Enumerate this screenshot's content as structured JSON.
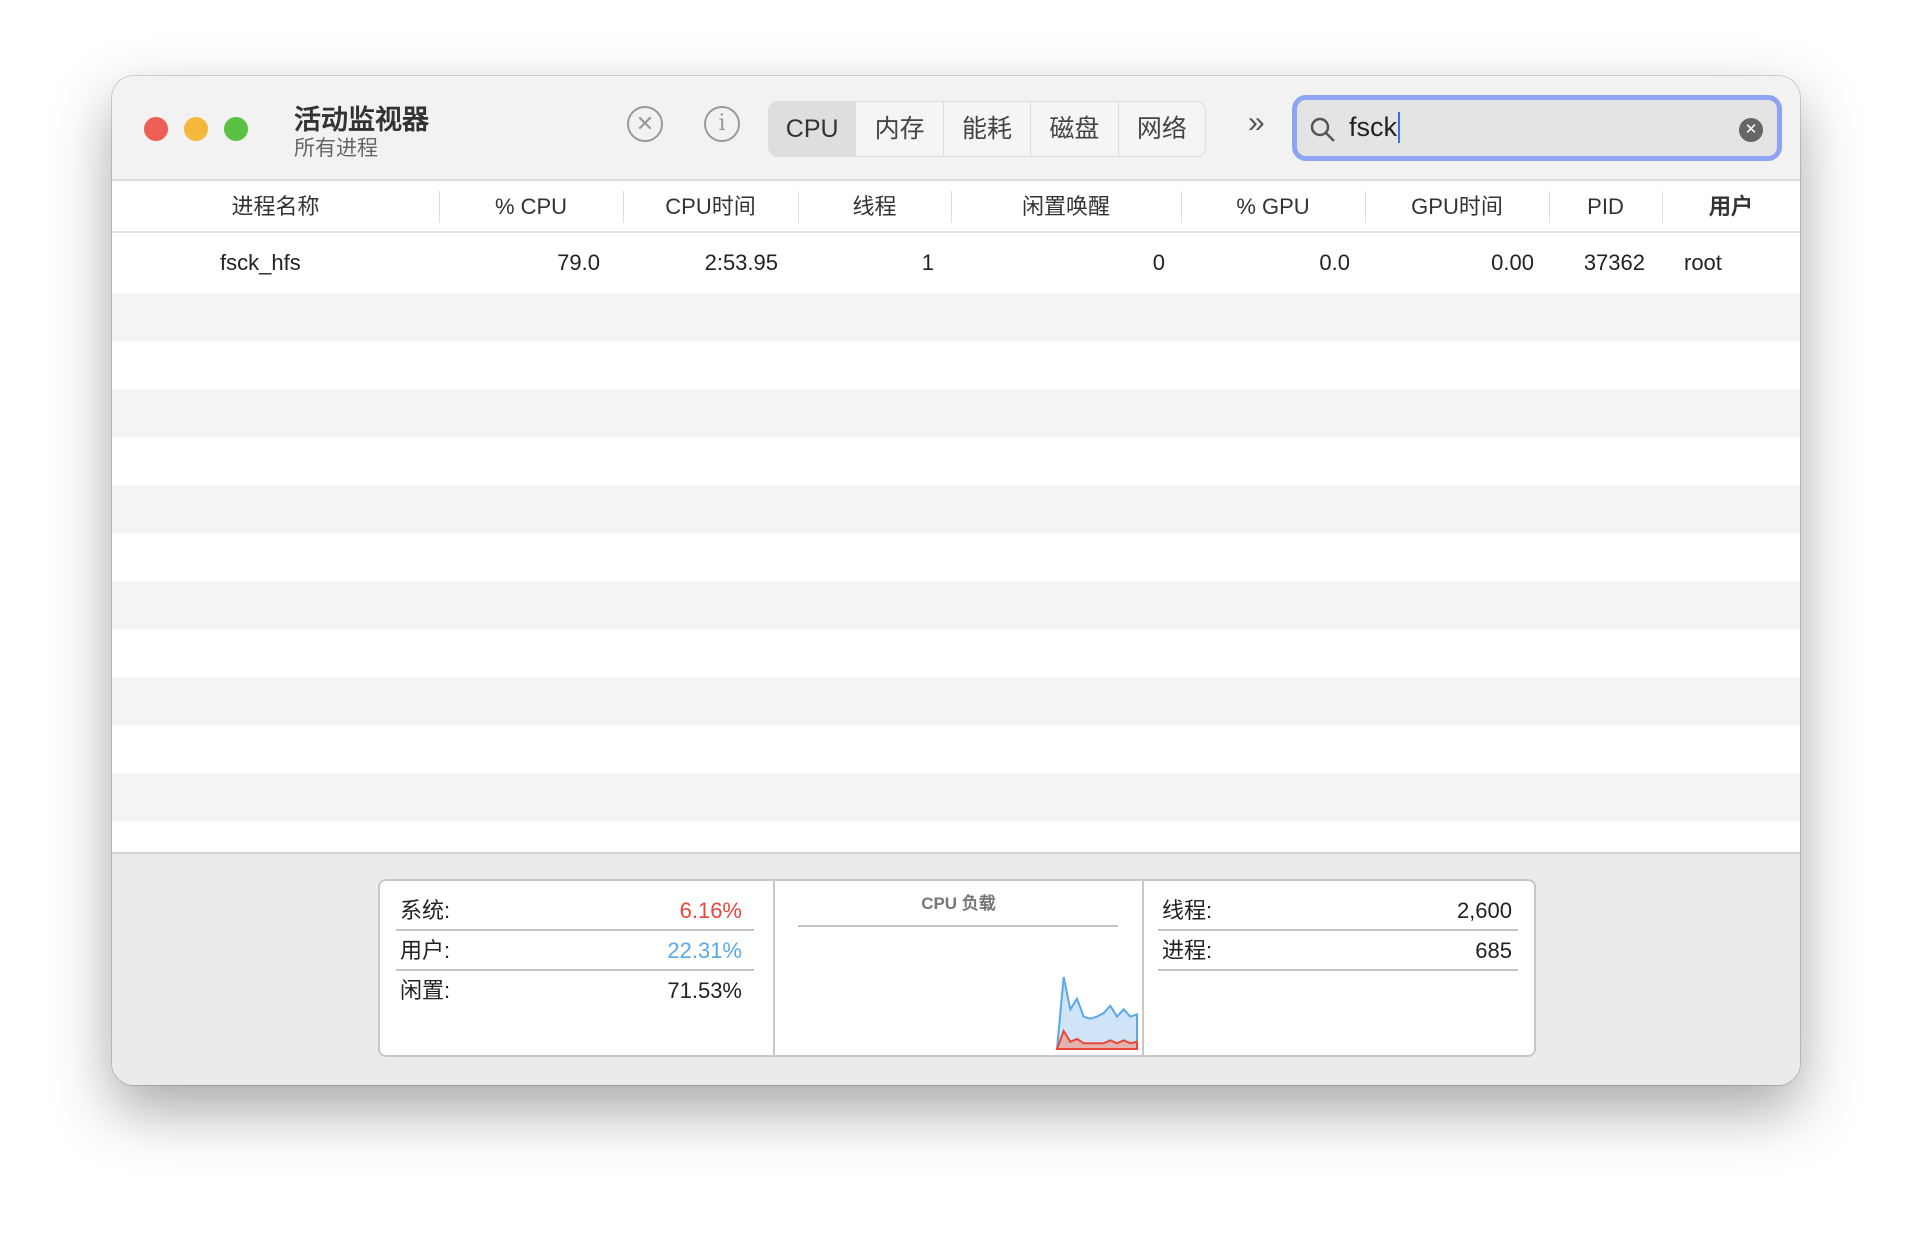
{
  "window": {
    "title": "活动监视器",
    "subtitle": "所有进程"
  },
  "toolbar": {
    "stop_icon": "x-circle-icon",
    "info_icon": "info-icon",
    "tabs": [
      {
        "label": "CPU",
        "active": true
      },
      {
        "label": "内存"
      },
      {
        "label": "能耗"
      },
      {
        "label": "磁盘"
      },
      {
        "label": "网络"
      }
    ],
    "more_icon": "chevron-double-right-icon",
    "search": {
      "value": "fsck",
      "accent": "#8ea4f2"
    }
  },
  "table": {
    "columns": [
      "进程名称",
      "% CPU",
      "CPU时间",
      "线程",
      "闲置唤醒",
      "% GPU",
      "GPU时间",
      "PID",
      "用户"
    ],
    "rows": [
      {
        "name": "fsck_hfs",
        "cpu": "79.0",
        "cpu_time": "2:53.95",
        "threads": "1",
        "idle_wake": "0",
        "gpu": "0.0",
        "gpu_time": "0.00",
        "pid": "37362",
        "user": "root"
      }
    ]
  },
  "stats": {
    "system_label": "系统:",
    "system_value": "6.16%",
    "user_label": "用户:",
    "user_value": "22.31%",
    "idle_label": "闲置:",
    "idle_value": "71.53%",
    "chart_title": "CPU 负载",
    "threads_label": "线程:",
    "threads_value": "2,600",
    "processes_label": "进程:",
    "processes_value": "685",
    "colors": {
      "system": "#e8473a",
      "user": "#5aa9e6"
    }
  },
  "chart_data": {
    "type": "area",
    "title": "CPU 负载",
    "ylim": [
      0,
      100
    ],
    "series": [
      {
        "name": "系统",
        "values": [
          0,
          25,
          10,
          14,
          8,
          8,
          8,
          8,
          12,
          8,
          12,
          8,
          10
        ]
      },
      {
        "name": "用户",
        "values": [
          0,
          100,
          55,
          70,
          45,
          42,
          45,
          50,
          60,
          45,
          55,
          45,
          48
        ]
      }
    ]
  }
}
